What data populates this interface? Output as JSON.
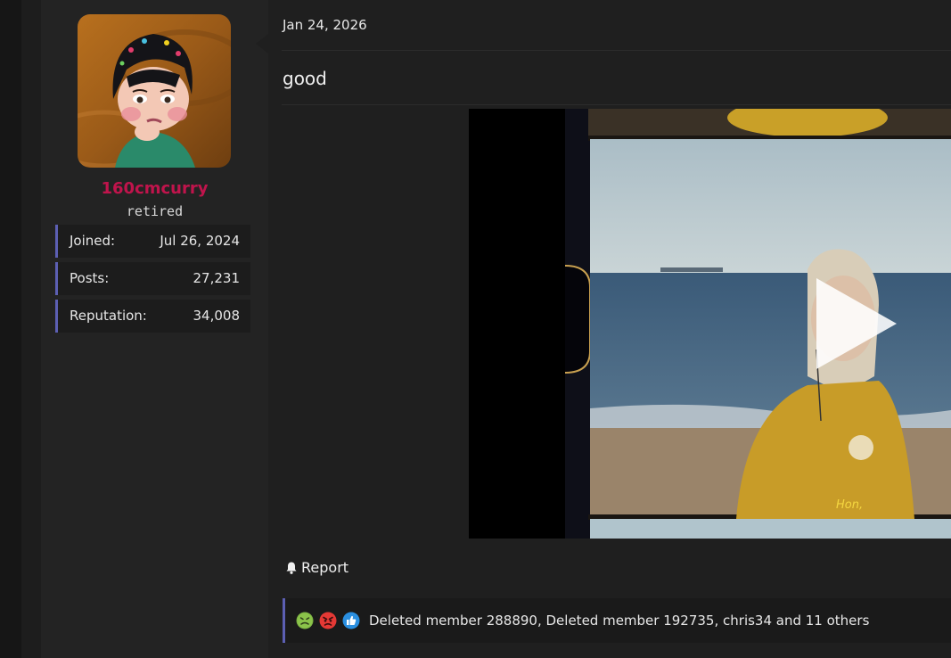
{
  "post": {
    "date": "Jan 24, 2026",
    "message": "good",
    "report_label": "Report"
  },
  "user": {
    "name": "160cmcurry",
    "title": "retired",
    "name_color": "#c0144c",
    "stats": [
      {
        "label": "Joined:",
        "value": "Jul 26, 2024"
      },
      {
        "label": "Posts:",
        "value": "27,231"
      },
      {
        "label": "Reputation:",
        "value": "34,008"
      }
    ]
  },
  "video": {
    "subtitle": "Hon,",
    "play_icon": "play-icon"
  },
  "reactions": {
    "icons": [
      "sick-face-icon",
      "angry-face-icon",
      "thumbs-up-icon"
    ],
    "text": "Deleted member 288890, Deleted member 192735, chris34 and 11 others"
  },
  "colors": {
    "accent": "#5c5fb3",
    "username": "#c0144c"
  }
}
